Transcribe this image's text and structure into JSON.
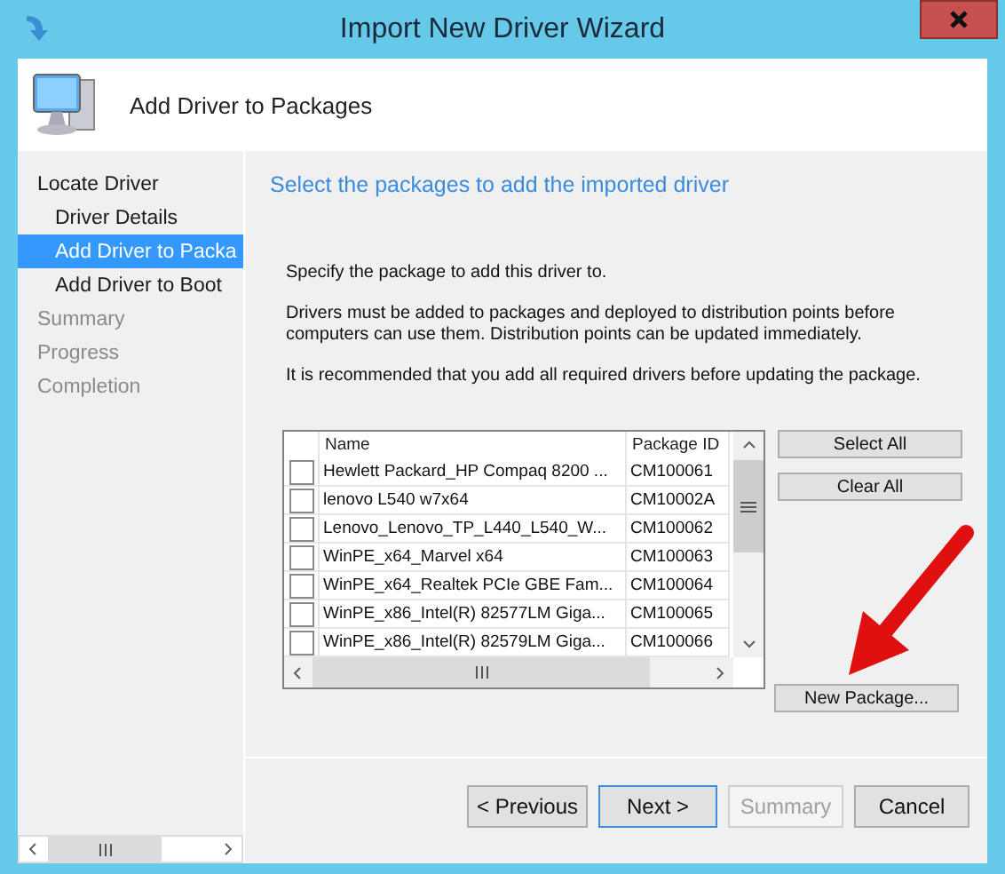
{
  "window": {
    "title": "Import New Driver Wizard"
  },
  "header": {
    "title": "Add Driver to Packages"
  },
  "steps": [
    {
      "label": "Locate Driver",
      "selected": false,
      "disabled": false,
      "children": [
        {
          "label": "Driver Details",
          "selected": false,
          "disabled": false
        },
        {
          "label": "Add Driver to Packa",
          "selected": true,
          "disabled": false
        },
        {
          "label": "Add Driver to Boot",
          "selected": false,
          "disabled": false
        }
      ]
    },
    {
      "label": "Summary",
      "selected": false,
      "disabled": true
    },
    {
      "label": "Progress",
      "selected": false,
      "disabled": true
    },
    {
      "label": "Completion",
      "selected": false,
      "disabled": true
    }
  ],
  "page": {
    "heading": "Select the packages to add the imported driver",
    "paragraphs": [
      "Specify the package to add this driver to.",
      "Drivers must be added to packages and deployed to distribution points before computers can use them.  Distribution points can be updated immediately.",
      "It is recommended that you add all required drivers before updating the package."
    ]
  },
  "packages": {
    "columns": [
      "Name",
      "Package ID"
    ],
    "rows": [
      {
        "checked": false,
        "name": "Hewlett Packard_HP Compaq 8200 ...",
        "package_id": "CM100061"
      },
      {
        "checked": false,
        "name": "lenovo L540 w7x64",
        "package_id": "CM10002A"
      },
      {
        "checked": false,
        "name": "Lenovo_Lenovo_TP_L440_L540_W...",
        "package_id": "CM100062"
      },
      {
        "checked": false,
        "name": "WinPE_x64_Marvel x64",
        "package_id": "CM100063"
      },
      {
        "checked": false,
        "name": "WinPE_x64_Realtek PCIe GBE Fam...",
        "package_id": "CM100064"
      },
      {
        "checked": false,
        "name": "WinPE_x86_Intel(R) 82577LM Giga...",
        "package_id": "CM100065"
      },
      {
        "checked": false,
        "name": "WinPE_x86_Intel(R) 82579LM Giga...",
        "package_id": "CM100066"
      }
    ]
  },
  "list_buttons": [
    "Select All",
    "Clear All"
  ],
  "new_package_button": "New Package...",
  "footer_buttons": [
    {
      "label": "< Previous",
      "disabled": false,
      "default": false
    },
    {
      "label": "Next >",
      "disabled": false,
      "default": true
    },
    {
      "label": "Summary",
      "disabled": true,
      "default": false
    },
    {
      "label": "Cancel",
      "disabled": false,
      "default": false
    }
  ]
}
